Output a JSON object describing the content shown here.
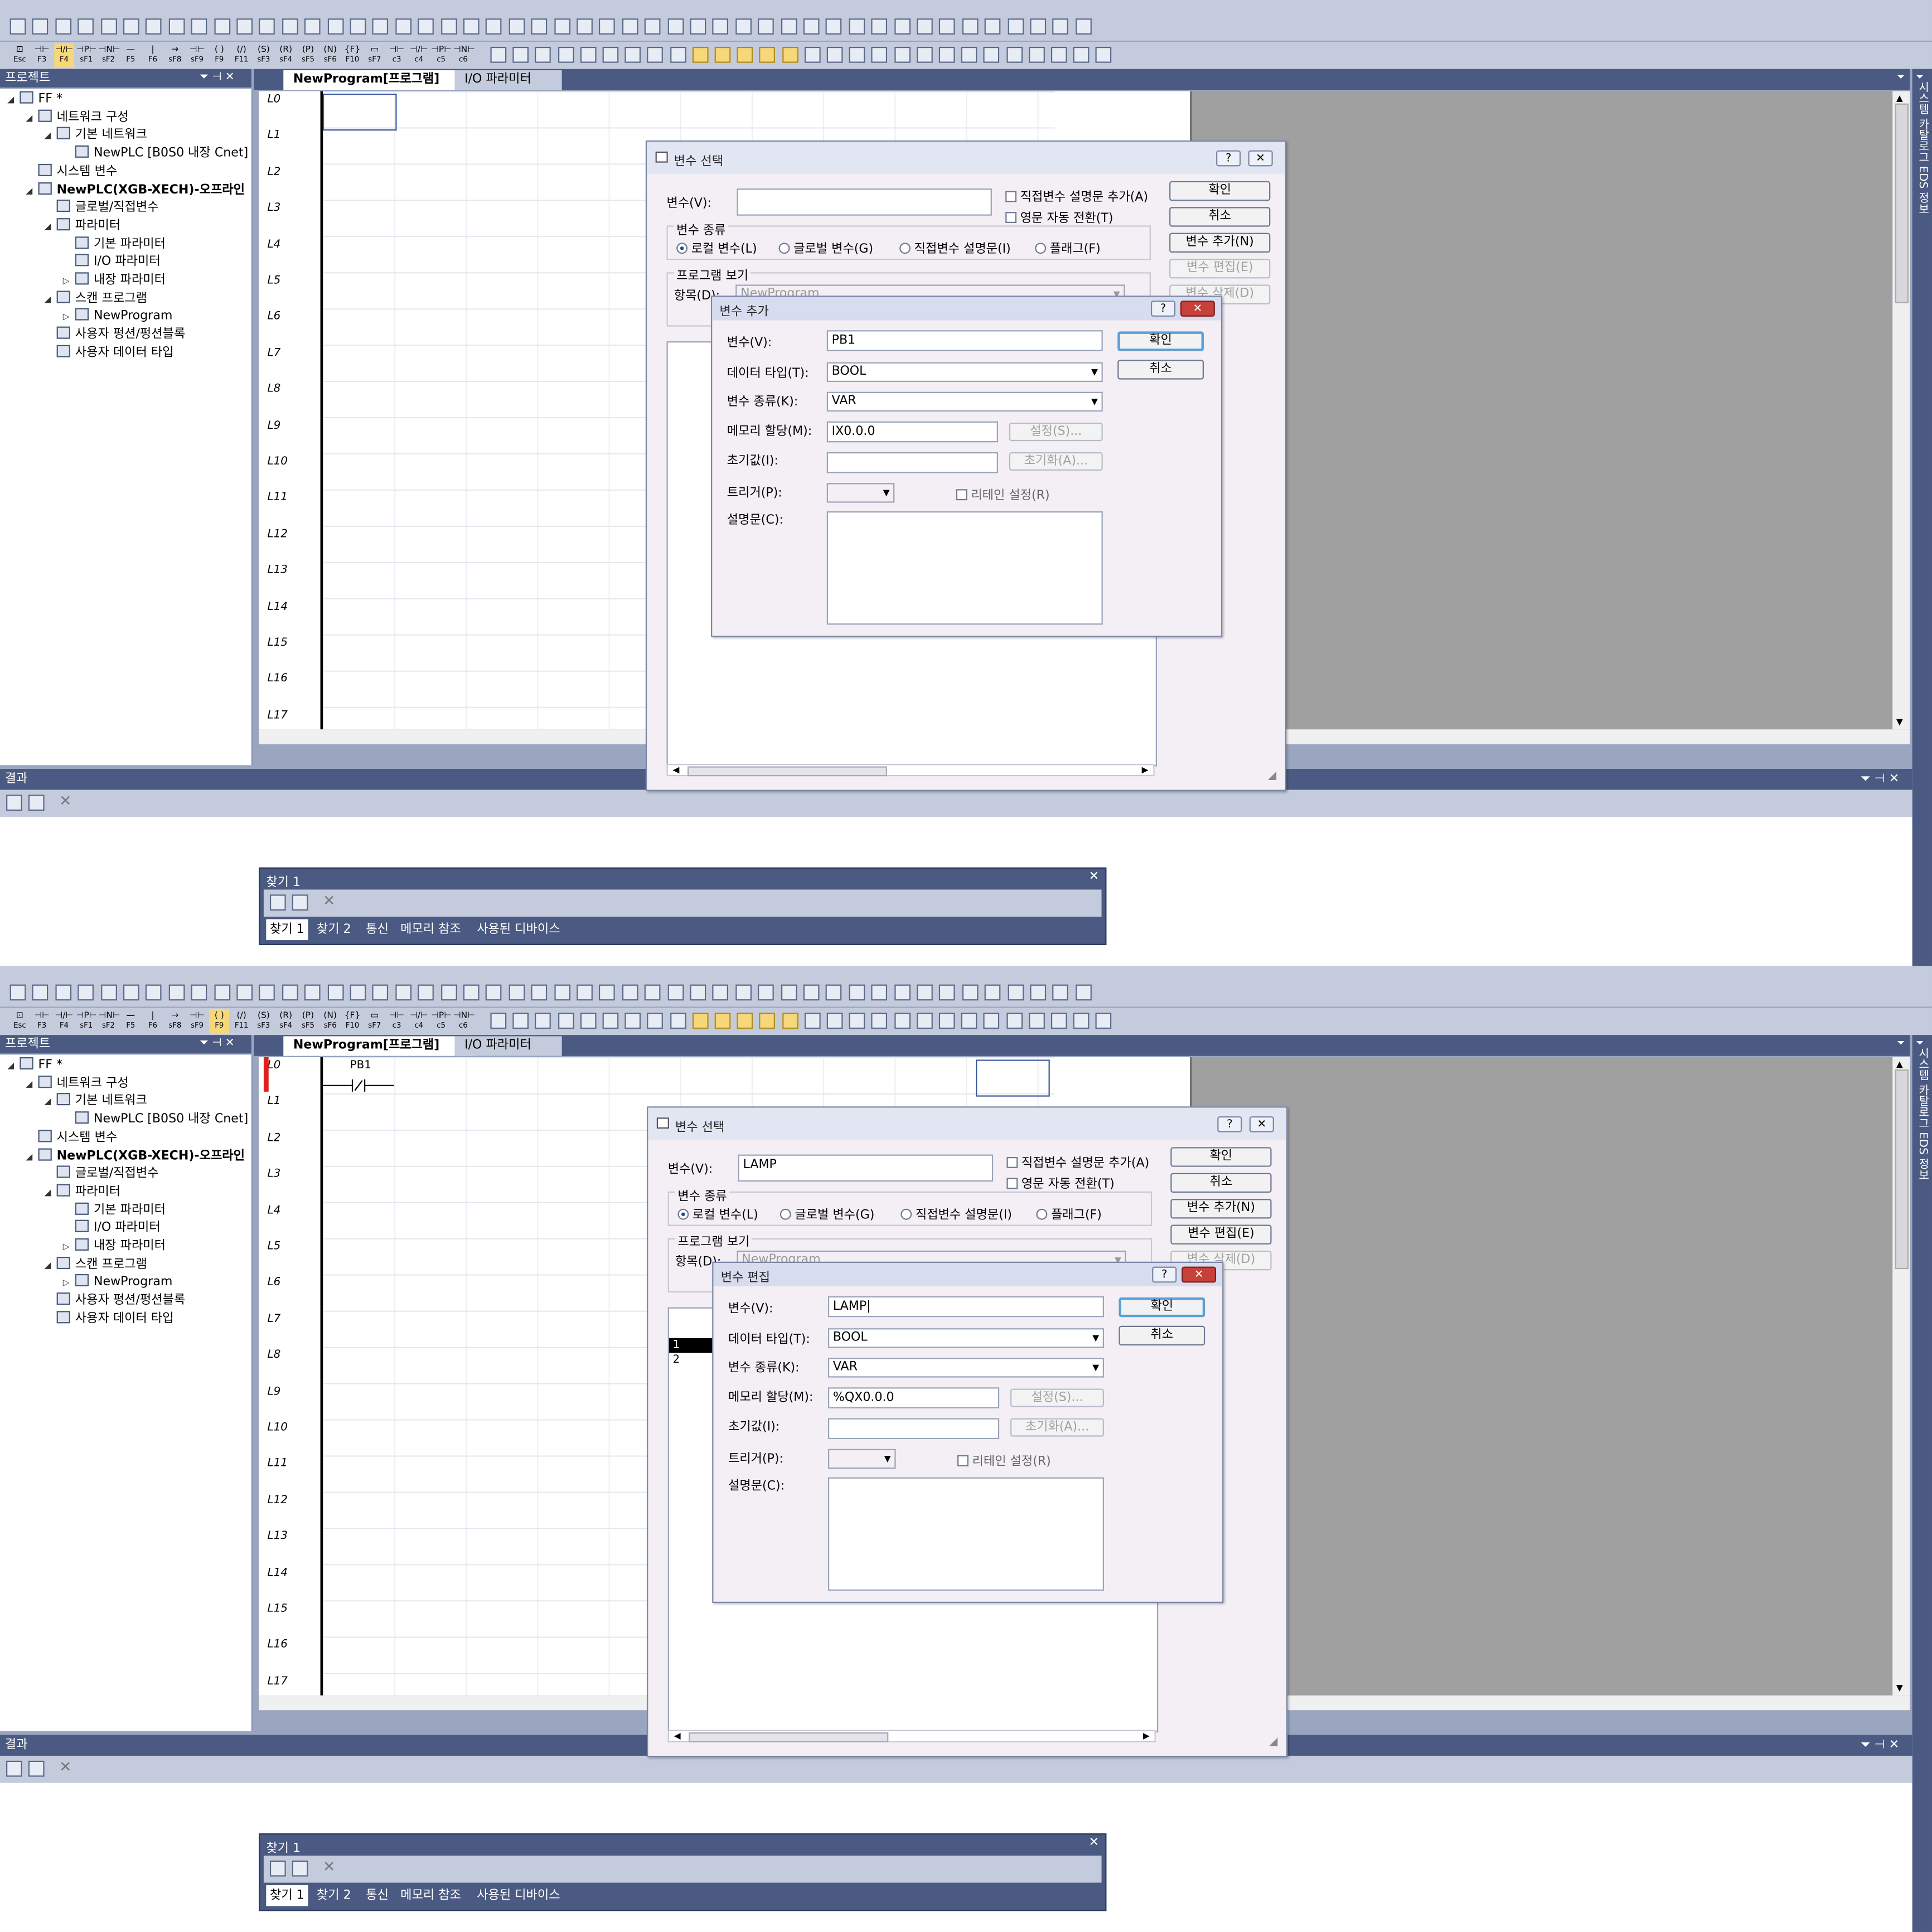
{
  "fkeys": [
    {
      "sym": "⊡",
      "label": "Esc"
    },
    {
      "sym": "⊣⊢",
      "label": "F3"
    },
    {
      "sym": "⊣/⊢",
      "label": "F4"
    },
    {
      "sym": "⊣P⊢",
      "label": "sF1"
    },
    {
      "sym": "⊣N⊢",
      "label": "sF2"
    },
    {
      "sym": "—",
      "label": "F5"
    },
    {
      "sym": "|",
      "label": "F6"
    },
    {
      "sym": "→",
      "label": "sF8"
    },
    {
      "sym": "⊣⊢",
      "label": "sF9"
    },
    {
      "sym": "( )",
      "label": "F9"
    },
    {
      "sym": "(/)",
      "label": "F11"
    },
    {
      "sym": "(S)",
      "label": "sF3"
    },
    {
      "sym": "(R)",
      "label": "sF4"
    },
    {
      "sym": "(P)",
      "label": "sF5"
    },
    {
      "sym": "(N)",
      "label": "sF6"
    },
    {
      "sym": "{F}",
      "label": "F10"
    },
    {
      "sym": "▭",
      "label": "sF7"
    },
    {
      "sym": "⊣⊢",
      "label": "c3"
    },
    {
      "sym": "⊣/⊢",
      "label": "c4"
    },
    {
      "sym": "⊣P⊢",
      "label": "c5"
    },
    {
      "sym": "⊣N⊢",
      "label": "c6"
    }
  ],
  "project_panel": {
    "title": "프로젝트",
    "pin": "⏷ ⊣ ✕"
  },
  "tree": [
    {
      "label": "FF *",
      "level": 0,
      "exp": "◢"
    },
    {
      "label": "네트워크 구성",
      "level": 1,
      "exp": "◢"
    },
    {
      "label": "기본 네트워크",
      "level": 2,
      "exp": "◢"
    },
    {
      "label": "NewPLC [B0S0 내장 Cnet]",
      "level": 3,
      "exp": ""
    },
    {
      "label": "시스템 변수",
      "level": 1,
      "exp": ""
    },
    {
      "label": "NewPLC(XGB-XECH)-오프라인",
      "level": 1,
      "exp": "◢",
      "bold": true
    },
    {
      "label": "글로벌/직접변수",
      "level": 2,
      "exp": ""
    },
    {
      "label": "파라미터",
      "level": 2,
      "exp": "◢"
    },
    {
      "label": "기본 파라미터",
      "level": 3,
      "exp": ""
    },
    {
      "label": "I/O 파라미터",
      "level": 3,
      "exp": ""
    },
    {
      "label": "내장 파라미터",
      "level": 3,
      "exp": "▷"
    },
    {
      "label": "스캔 프로그램",
      "level": 2,
      "exp": "◢"
    },
    {
      "label": "NewProgram",
      "level": 3,
      "exp": "▷"
    },
    {
      "label": "사용자 펑션/펑션블록",
      "level": 2,
      "exp": ""
    },
    {
      "label": "사용자 데이터 타입",
      "level": 2,
      "exp": ""
    }
  ],
  "tabs": {
    "program": "NewProgram[프로그램]",
    "io": "I/O 파라미터",
    "close": "✕"
  },
  "rows": [
    "L0",
    "L1",
    "L2",
    "L3",
    "L4",
    "L5",
    "L6",
    "L7",
    "L8",
    "L9",
    "L10",
    "L11",
    "L12",
    "L13",
    "L14",
    "L15",
    "L16",
    "L17"
  ],
  "right_strip": "시스템 카탈로그  EDS 정보",
  "results": {
    "title": "결과",
    "controls": "⏷ ⊣ ✕"
  },
  "find": {
    "title": "찾기 1",
    "close": "✕",
    "tabs": [
      "찾기 1",
      "찾기 2",
      "통신",
      "메모리 참조",
      "사용된 디바이스"
    ]
  },
  "varselect": {
    "title": "변수 선택",
    "var_label": "변수(V):",
    "chk1": "직접변수 설명문 추가(A)",
    "chk2": "영문 자동 전환(T)",
    "kind_group": "변수 종류",
    "radios": [
      "로컬 변수(L)",
      "글로벌 변수(G)",
      "직접변수 설명문(I)",
      "플래그(F)"
    ],
    "program_group": "프로그램 보기",
    "item_label": "항목(D):",
    "item_value": "NewProgram",
    "buttons": {
      "ok": "확인",
      "cancel": "취소",
      "add": "변수 추가(N)",
      "edit": "변수 편집(E)",
      "delete": "변수 삭제(D)"
    },
    "help": "?",
    "close": "✕"
  },
  "subdialog_fields": {
    "var": "변수(V):",
    "type": "데이터 타입(T):",
    "kind": "변수 종류(K):",
    "mem": "메모리 할당(M):",
    "init": "초기값(I):",
    "trigger": "트리거(P):",
    "retain": "리테인 설정(R)",
    "comment": "설명문(C):",
    "set_btn": "설정(S)...",
    "init_btn": "초기화(A)...",
    "ok": "확인",
    "cancel": "취소"
  },
  "top": {
    "varselect_value": "",
    "sub_title": "변수 추가",
    "var": "PB1",
    "type": "BOOL",
    "kind": "VAR",
    "mem": "IX0.0.0",
    "init": ""
  },
  "bottom": {
    "varselect_value": "LAMP",
    "sub_title": "변수 편집",
    "var": "LAMP|",
    "type": "BOOL",
    "kind": "VAR",
    "mem": "%QX0.0.0",
    "init": "",
    "list_rows": [
      "1",
      "2"
    ],
    "contact_label": "PB1"
  }
}
